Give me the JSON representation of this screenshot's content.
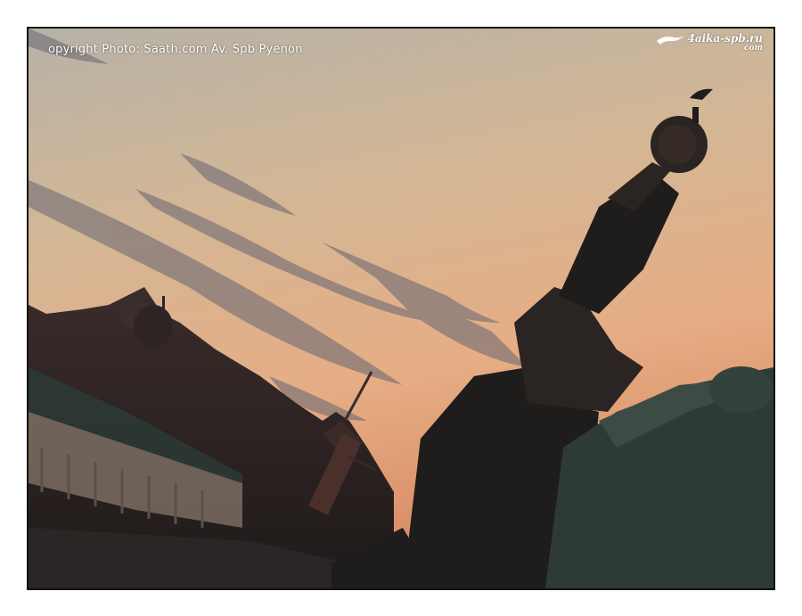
{
  "watermark": {
    "copyright": "opyright Photo: Saath.com Av. Spb Pyenon",
    "logo_line1": "4aika-spb.ru",
    "logo_line2": "com"
  },
  "colors": {
    "sky_top": "#b9b1a4",
    "sky_mid": "#d9b28c",
    "sky_low": "#e8a57c",
    "silhouette": "#1c1c1c",
    "roof_green": "#2d3a34",
    "border": "#111111"
  }
}
